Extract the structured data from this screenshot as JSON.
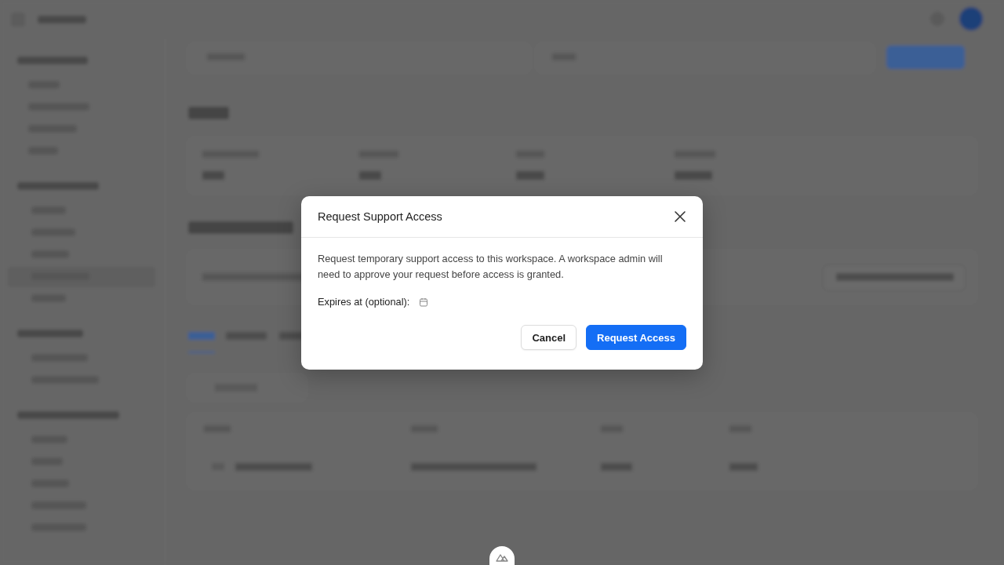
{
  "dialog": {
    "title": "Request Support Access",
    "description": "Request temporary support access to this workspace. A workspace admin will need to approve your request before access is granted.",
    "field": {
      "label": "Expires at (optional):"
    },
    "buttons": [
      {
        "label": "Cancel",
        "kind": "secondary"
      },
      {
        "label": "Request Access",
        "kind": "primary"
      }
    ]
  }
}
